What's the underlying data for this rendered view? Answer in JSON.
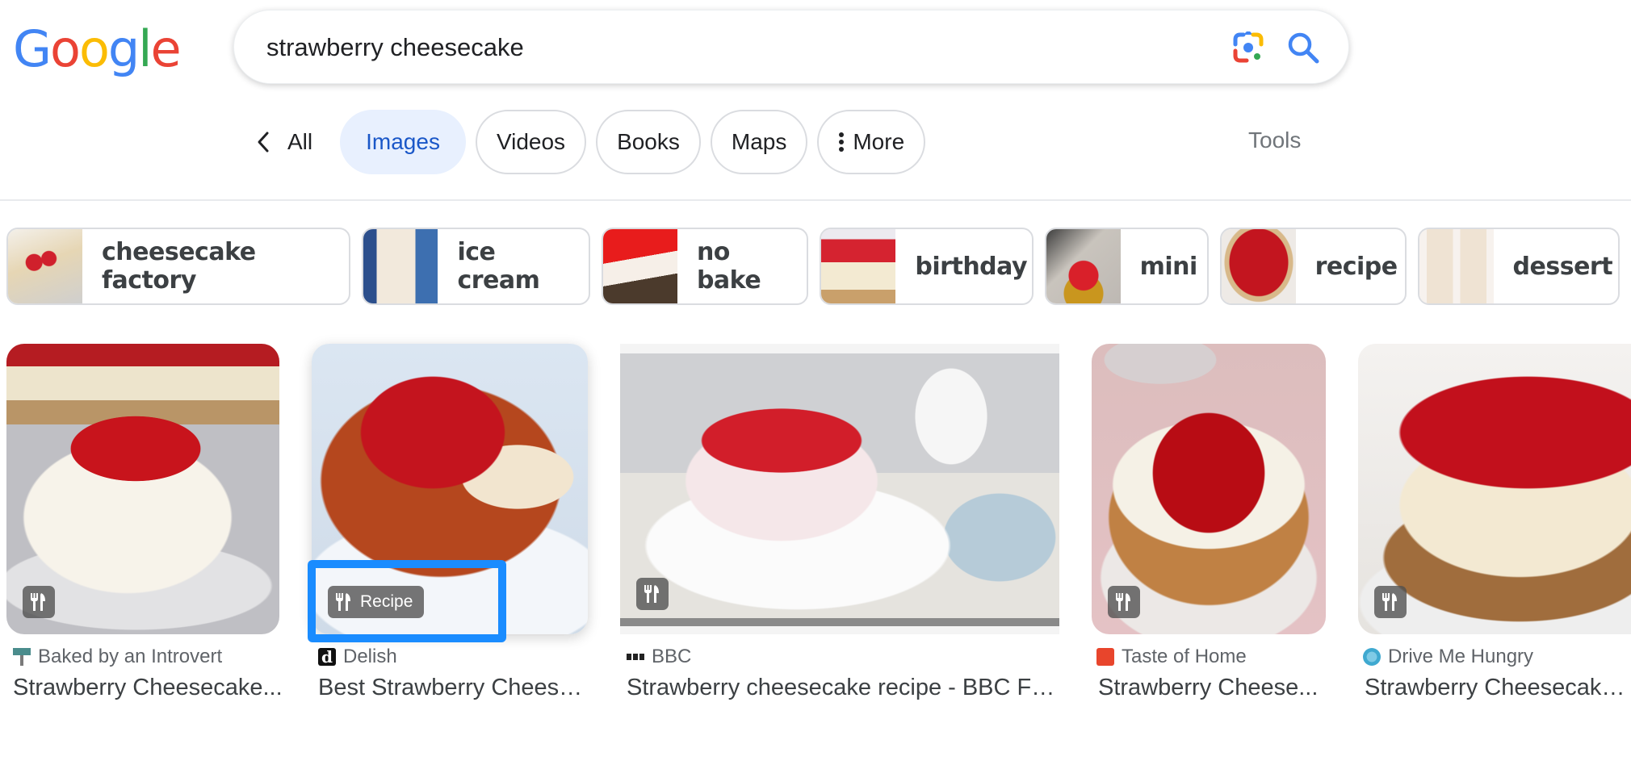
{
  "logo": {
    "text": "Google",
    "letters": [
      {
        "ch": "G",
        "color": "#4285F4"
      },
      {
        "ch": "o",
        "color": "#EA4335"
      },
      {
        "ch": "o",
        "color": "#FBBC05"
      },
      {
        "ch": "g",
        "color": "#4285F4"
      },
      {
        "ch": "l",
        "color": "#34A853"
      },
      {
        "ch": "e",
        "color": "#EA4335"
      }
    ]
  },
  "search": {
    "query": "strawberry cheesecake",
    "lens_icon": "google-lens-icon",
    "search_icon": "magnifier-icon"
  },
  "tabs": {
    "back_label": "All",
    "items": [
      {
        "label": "Images",
        "active": true
      },
      {
        "label": "Videos",
        "active": false
      },
      {
        "label": "Books",
        "active": false
      },
      {
        "label": "Maps",
        "active": false
      },
      {
        "label": "More",
        "active": false,
        "icon": "vertical-dots-icon"
      }
    ],
    "tools_label": "Tools"
  },
  "refinements": [
    {
      "label": "cheesecake factory",
      "thumb": "cheesecake-slice-with-strawberries"
    },
    {
      "label": "ice cream",
      "thumb": "ice-cream-tub"
    },
    {
      "label": "no bake",
      "thumb": "no-bake-cheesecake"
    },
    {
      "label": "birthday",
      "thumb": "birthday-cheesecake"
    },
    {
      "label": "mini",
      "thumb": "mini-cheesecake-on-fork"
    },
    {
      "label": "recipe",
      "thumb": "strawberry-glazed-cheesecake"
    },
    {
      "label": "dessert",
      "thumb": "dessert-cups"
    }
  ],
  "results": [
    {
      "source": "Baked by an Introvert",
      "title": "Strawberry Cheesecake...",
      "badge": "",
      "badge_icon": "fork-knife-icon",
      "favicon_color": "#4a8c8c"
    },
    {
      "source": "Delish",
      "title": "Best Strawberry Cheese...",
      "badge": "Recipe",
      "badge_icon": "fork-knife-icon",
      "favicon_color": "#111111"
    },
    {
      "source": "BBC",
      "title": "Strawberry cheesecake recipe - BBC Fo...",
      "badge": "",
      "badge_icon": "fork-knife-icon",
      "favicon_color": "#222222"
    },
    {
      "source": "Taste of Home",
      "title": "Strawberry Cheese...",
      "badge": "",
      "badge_icon": "fork-knife-icon",
      "favicon_color": "#e8452c"
    },
    {
      "source": "Drive Me Hungry",
      "title": "Strawberry Cheesecake...",
      "badge": "",
      "badge_icon": "fork-knife-icon",
      "favicon_color": "#3fa9d0"
    }
  ],
  "colors": {
    "accent_blue": "#1a57c8",
    "active_tab_bg": "#e8f0fe",
    "highlight": "#1a8cff"
  }
}
